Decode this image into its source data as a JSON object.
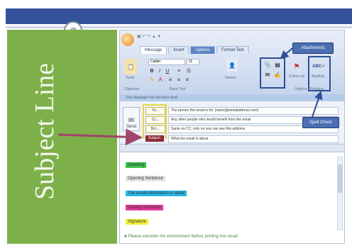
{
  "slide": {
    "side_title": "Subject Line"
  },
  "ribbon": {
    "tabs": [
      {
        "label": "Message"
      },
      {
        "label": "Insert"
      },
      {
        "label": "Options"
      },
      {
        "label": "Format Text"
      }
    ],
    "font_name": "Calibri",
    "font_size": "11",
    "paste_label": "Paste",
    "clipboard_label": "Clipboard",
    "basic_text_label": "Basic Text",
    "names_label": "Names",
    "options_label": "Options",
    "follow_up_label": "Follow Up",
    "spelling_label": "Spelling",
    "proofing_label": "Proofing"
  },
  "callouts": {
    "attachments": "Attachments",
    "spell_check": "Spell Check"
  },
  "compose": {
    "notice": "This message has not been sent.",
    "send_label": "Send",
    "to_label": "To...",
    "cc_label": "Cc...",
    "bcc_label": "Bcc...",
    "subject_label": "Subject:",
    "to_value": "The person the email is for. (name@emailaddress.com)",
    "cc_value": "Any other people who would benefit from the email",
    "bcc_value": "Same as CC, only no one can see this address",
    "subject_value": "What the email is about"
  },
  "body_sections": [
    {
      "label": "Greeting",
      "color": "#39c24a"
    },
    {
      "label": "Opening Sentence",
      "color": "#e3e3e3"
    },
    {
      "label": "The email information in detail",
      "color": "#29b6e6"
    },
    {
      "label": "Closing Sentence",
      "color": "#e0389a"
    },
    {
      "label": "Signature",
      "color": "#f2ef3a"
    }
  ],
  "footer_note": "Please consider the environment before printing this email",
  "colors": {
    "top_bar": "#34519a",
    "side_panel": "#7db049",
    "callout": "#4b6fb2",
    "arrow": "#a0466a"
  }
}
